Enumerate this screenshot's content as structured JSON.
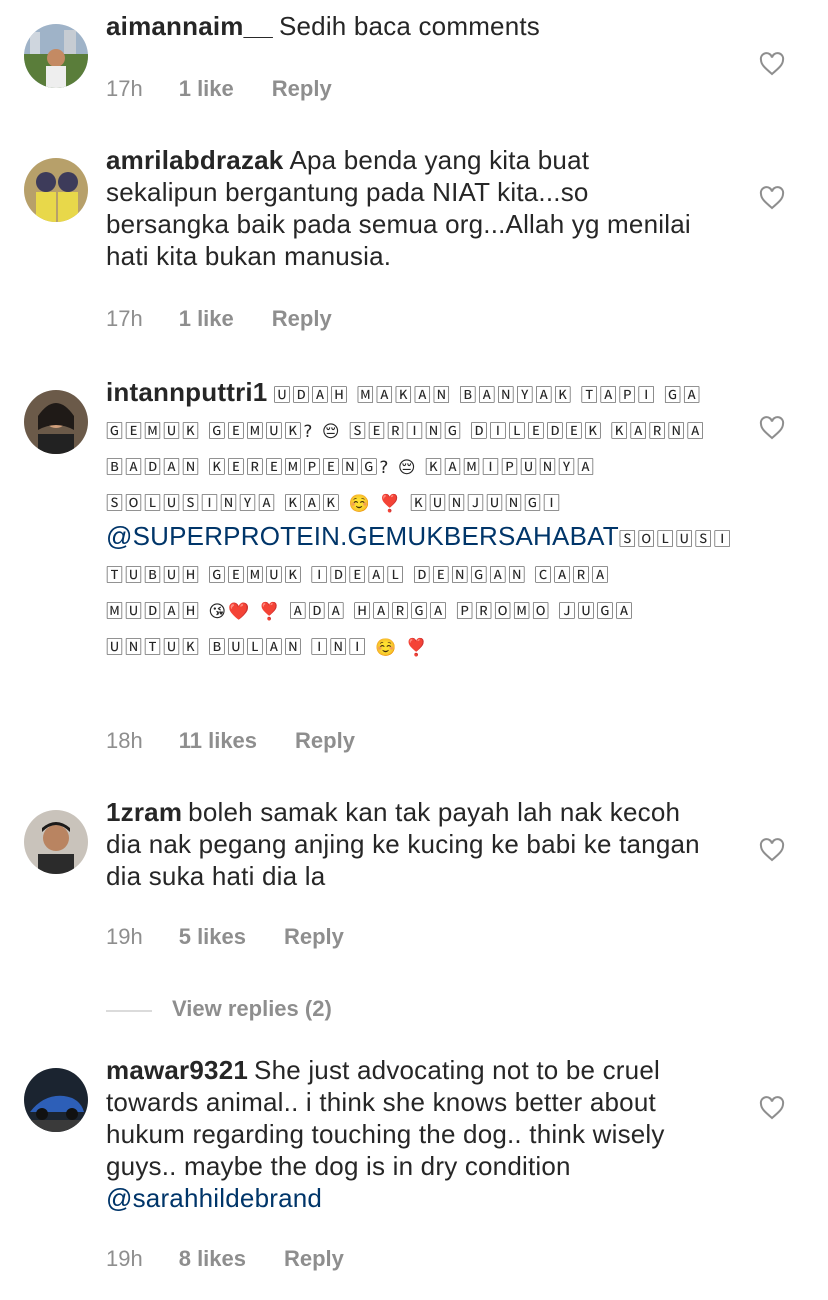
{
  "comments": [
    {
      "username": "aimannaim__",
      "text": "Sedih baca comments",
      "time": "17h",
      "likes": "1 like",
      "reply": "Reply"
    },
    {
      "username": "amrilabdrazak",
      "text": "Apa benda yang kita buat sekalipun bergantung pada NIAT kita...so bersangka baik pada semua org...Allah yg menilai hati kita bukan manusia.",
      "time": "17h",
      "likes": "1 like",
      "reply": "Reply"
    },
    {
      "username": "intannputtri1",
      "text_part1": "🅄🄳🄰🄷 🄼🄰🄺🄰🄽 🄱🄰🄽🅈🄰🄺 🅃🄰🄿🄸 🄶🄰 🄶🄴🄼🅄🄺 🄶🄴🄼🅄🄺? 😔 🅂🄴🅁🄸🄽🄶 🄳🄸🄻🄴🄳🄴🄺 🄺🄰🅁🄽🄰 🄱🄰🄳🄰🄽 🄺🄴🅁🄴🄼🄿🄴🄽🄶? 😔 🄺🄰🄼🄸🄿🅄🄽🅈🄰 🅂🄾🄻🅄🅂🄸🄽🅈🄰 🄺🄰🄺 ☺️ ❣️ 🄺🅄🄽🄹🅄🄽🄶🄸",
      "mention": "@SUPERPROTEIN.GEMUKBERSAHABAT",
      "text_part2": "🅂🄾🄻🅄🅂🄸 🅃🅄🄱🅄🄷 🄶🄴🄼🅄🄺 🄸🄳🄴🄰🄻 🄳🄴🄽🄶🄰🄽 🄲🄰🅁🄰 🄼🅄🄳🄰🄷 😘❤️ ❣️ 🄰🄳🄰 🄷🄰🅁🄶🄰 🄿🅁🄾🄼🄾 🄹🅄🄶🄰 🅄🄽🅃🅄🄺 🄱🅄🄻🄰🄽 🄸🄽🄸 ☺️ ❣️",
      "time": "18h",
      "likes": "11 likes",
      "reply": "Reply"
    },
    {
      "username": "1zram",
      "text": "boleh samak kan tak payah lah nak kecoh dia nak pegang anjing ke kucing ke babi ke tangan dia suka hati dia la",
      "time": "19h",
      "likes": "5 likes",
      "reply": "Reply"
    },
    {
      "username": "mawar9321",
      "text": "She just advocating not to be cruel towards animal.. i think she knows better about hukum regarding touching the dog.. think wisely guys.. maybe the dog is in dry condition",
      "mention": "@sarahhildebrand",
      "time": "19h",
      "likes": "8 likes",
      "reply": "Reply"
    }
  ],
  "view_replies": "View replies (2)",
  "icons": {
    "like": "heart-outline-icon",
    "avatar": "user-avatar"
  },
  "colors": {
    "text": "#262626",
    "meta": "#8e8e8e",
    "mention": "#003569"
  }
}
